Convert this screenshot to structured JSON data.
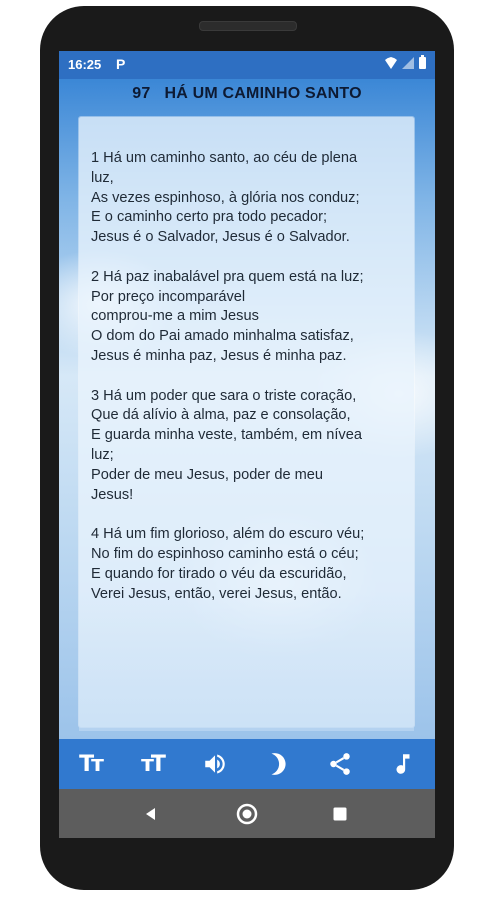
{
  "status": {
    "time": "16:25",
    "notification_glyph": "P",
    "icons": [
      "wifi-icon",
      "no-signal-icon",
      "battery-icon"
    ]
  },
  "hymn": {
    "number": "97",
    "title": "HÁ UM CAMINHO SANTO",
    "stanzas": [
      [
        "1 Há um caminho santo, ao céu de plena",
        "luz,",
        "As vezes espinhoso, à glória nos conduz;",
        "E o caminho certo pra todo pecador;",
        "Jesus é o Salvador, Jesus é o Salvador."
      ],
      [
        "2 Há paz inabalável pra quem está na luz;",
        "Por preço incomparável",
        "comprou-me a mim Jesus",
        "O dom do Pai amado minhalma satisfaz,",
        "Jesus é minha paz, Jesus é minha paz."
      ],
      [
        "3 Há um poder que sara o triste coração,",
        "Que dá alívio à alma, paz e consolação,",
        "E guarda minha veste, também, em nívea",
        "luz;",
        "Poder de meu Jesus, poder de meu",
        "Jesus!"
      ],
      [
        "4 Há um fim glorioso, além do escuro véu;",
        "No fim do espinhoso caminho está o céu;",
        "E quando for tirado o véu da escuridão,",
        "Verei Jesus, então, verei Jesus, então."
      ]
    ]
  },
  "toolbar": {
    "decrease_font_label": "Tт",
    "increase_font_label": "тT",
    "icons": [
      "decrease-font-icon",
      "increase-font-icon",
      "speaker-icon",
      "night-mode-icon",
      "share-icon",
      "music-note-icon"
    ]
  },
  "navbar": {
    "icons": [
      "back-icon",
      "home-icon",
      "recents-icon"
    ]
  },
  "colors": {
    "status_bar": "#2e6fc2",
    "toolbar": "#3179cf",
    "navbar": "#5d5d5d",
    "text": "#1f2a36"
  }
}
